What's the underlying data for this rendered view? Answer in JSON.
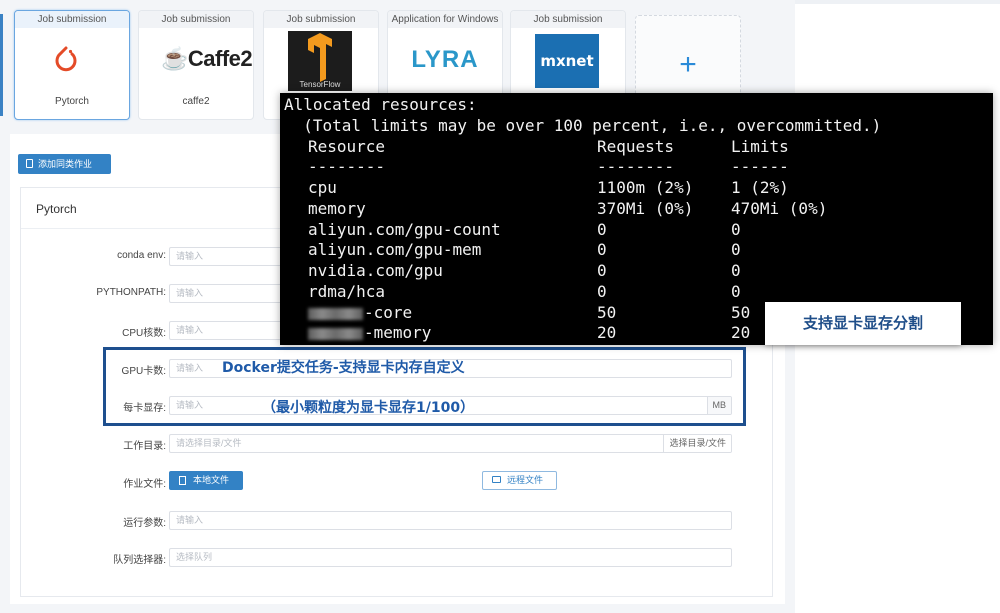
{
  "cards": [
    {
      "head": "Job submission",
      "label": "Pytorch",
      "logo": "pytorch-logo",
      "selected": true
    },
    {
      "head": "Job submission",
      "label": "caffe2",
      "logo_text": "Caffe2",
      "logo": "caffe2-logo"
    },
    {
      "head": "Job submission",
      "label": "",
      "logo_text": "TensorFlow",
      "logo": "tensorflow-logo"
    },
    {
      "head": "Application for Windows",
      "label": "",
      "logo_text": "LYRA",
      "logo": "lyra-logo"
    },
    {
      "head": "Job submission",
      "label": "",
      "logo_text": "mxnet",
      "logo": "mxnet-logo"
    }
  ],
  "add_card": {
    "icon": "plus-icon"
  },
  "form": {
    "add_button": "添加同类作业",
    "panel_title": "Pytorch",
    "rows": {
      "conda_env": {
        "label": "conda env:",
        "placeholder": "请输入"
      },
      "pythonpath": {
        "label": "PYTHONPATH:",
        "placeholder": "请输入"
      },
      "cpu": {
        "label": "CPU核数:",
        "placeholder": "请输入"
      },
      "gpu": {
        "label": "GPU卡数:",
        "placeholder": "请输入"
      },
      "gpu_mem": {
        "label": "每卡显存:",
        "placeholder": "请输入",
        "suffix": "MB"
      },
      "workdir": {
        "label": "工作目录:",
        "placeholder": "请选择目录/文件",
        "suffix": "选择目录/文件"
      },
      "jobfile": {
        "label": "作业文件:",
        "local_button": "本地文件",
        "remote_button": "远程文件"
      },
      "args": {
        "label": "运行参数:",
        "placeholder": "请输入"
      },
      "queue": {
        "label": "队列选择器:",
        "placeholder": "选择队列"
      }
    }
  },
  "highlight": {
    "line1": "Docker提交任务-支持显卡内存自定义",
    "line2": "（最小颗粒度为显卡显存1/100）"
  },
  "terminal": {
    "title": "Allocated resources:",
    "note": "  (Total limits may be over 100 percent, i.e., overcommitted.)",
    "header": {
      "name": "Resource",
      "req": "Requests",
      "lim": "Limits"
    },
    "dashes": {
      "name": "--------",
      "req": "--------",
      "lim": "------"
    },
    "rows": [
      {
        "name": "cpu",
        "req": "1100m (2%)",
        "lim": "1 (2%)"
      },
      {
        "name": "memory",
        "req": "370Mi (0%)",
        "lim": "470Mi (0%)"
      },
      {
        "name": "aliyun.com/gpu-count",
        "req": "0",
        "lim": "0"
      },
      {
        "name": "aliyun.com/gpu-mem",
        "req": "0",
        "lim": "0"
      },
      {
        "name": "nvidia.com/gpu",
        "req": "0",
        "lim": "0"
      },
      {
        "name": "rdma/hca",
        "req": "0",
        "lim": "0"
      },
      {
        "name": "-core",
        "req": "50",
        "lim": "50",
        "redacted": true
      },
      {
        "name": "-memory",
        "req": "20",
        "lim": "20",
        "redacted": true
      }
    ]
  },
  "callout": "支持显卡显存分割",
  "colors": {
    "accent": "#3382c5",
    "highlight_border": "#1e4f8e",
    "highlight_text": "#1f5aa8",
    "terminal_bg": "#000000"
  }
}
